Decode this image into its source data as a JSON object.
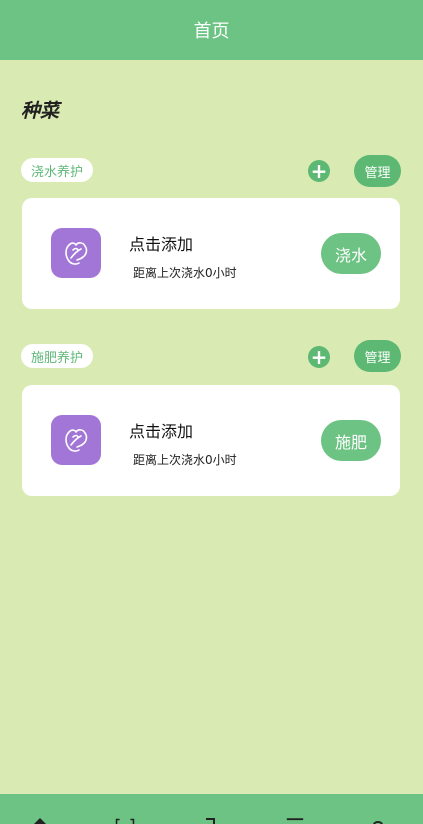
{
  "header": {
    "title": "首页"
  },
  "section": {
    "title": "种菜"
  },
  "groups": [
    {
      "label": "浇水养护",
      "plus": "+",
      "manage_label": "管理",
      "card": {
        "title": "点击添加",
        "subtitle": "距离上次浇水0小时",
        "action_label": "浇水",
        "icon": "lettuce-icon"
      }
    },
    {
      "label": "施肥养护",
      "plus": "+",
      "manage_label": "管理",
      "card": {
        "title": "点击添加",
        "subtitle": "距离上次浇水0小时",
        "action_label": "施肥",
        "icon": "lettuce-icon"
      }
    }
  ],
  "bottom_tabs": [
    {
      "icon": "home-icon"
    },
    {
      "icon": "scan-icon"
    },
    {
      "icon": "bookmark-icon"
    },
    {
      "icon": "list-icon"
    },
    {
      "icon": "user-icon"
    }
  ],
  "colors": {
    "primary": "#6cc383",
    "background": "#d9ebb3",
    "icon_bg": "#a276d6"
  }
}
